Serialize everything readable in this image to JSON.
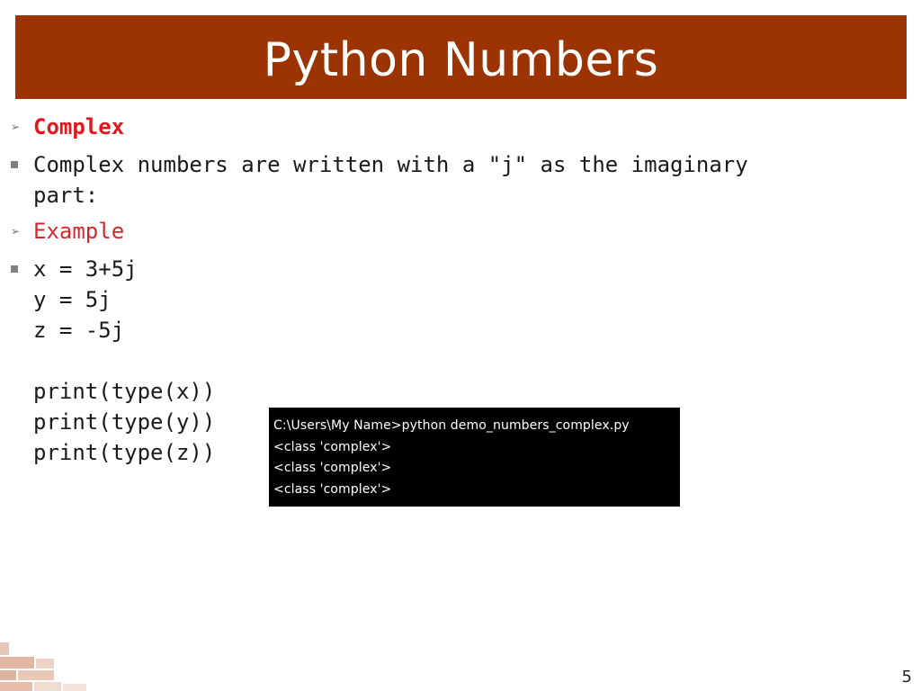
{
  "slide": {
    "title": "Python Numbers",
    "page_number": "5"
  },
  "bullets": [
    {
      "type": "arrow",
      "text": "Complex"
    },
    {
      "type": "square",
      "text": "Complex numbers are written with a \"j\" as the imaginary"
    },
    {
      "type": "continuation",
      "text": "part:"
    },
    {
      "type": "arrow",
      "text": "Example"
    }
  ],
  "code": {
    "lines": [
      "x = 3+5j",
      "y = 5j",
      "z = -5j",
      "",
      "print(type(x))",
      "print(type(y))",
      "print(type(z))"
    ]
  },
  "console": {
    "lines": [
      "C:\\Users\\My Name>python demo_numbers_complex.py",
      "<class 'complex'>",
      "<class 'complex'>",
      "<class 'complex'>"
    ]
  },
  "colors": {
    "title_bar": "#9b3402",
    "accent_red": "#e3151d",
    "console_bg": "#000000"
  },
  "icons": {
    "arrow_bullet": "arrowhead-icon",
    "square_bullet": "square-bullet-icon",
    "decoration": "brick-wall-decoration"
  }
}
